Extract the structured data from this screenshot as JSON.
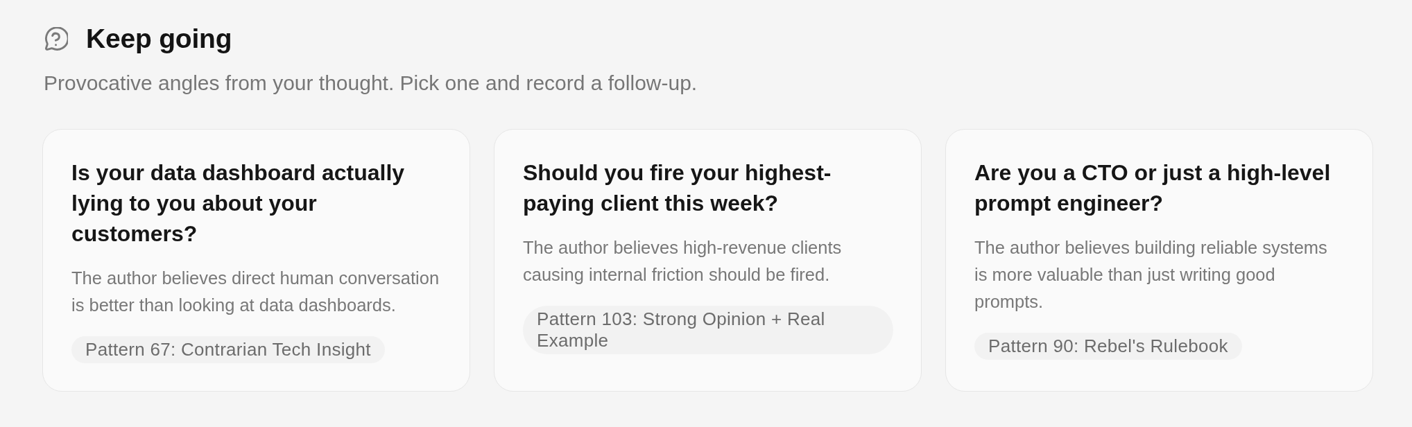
{
  "header": {
    "title": "Keep going",
    "subtitle": "Provocative angles from your thought. Pick one and record a follow-up."
  },
  "cards": [
    {
      "question": "Is your data dashboard actually lying to you about your customers?",
      "summary": "The author believes direct human conversation is better than looking at data dashboards.",
      "pattern": "Pattern 67: Contrarian Tech Insight"
    },
    {
      "question": "Should you fire your highest-paying client this week?",
      "summary": "The author believes high-revenue clients causing internal friction should be fired.",
      "pattern": "Pattern 103: Strong Opinion + Real Example"
    },
    {
      "question": "Are you a CTO or just a high-level prompt engineer?",
      "summary": "The author believes building reliable systems is more valuable than just writing good prompts.",
      "pattern": "Pattern 90: Rebel's Rulebook"
    }
  ]
}
